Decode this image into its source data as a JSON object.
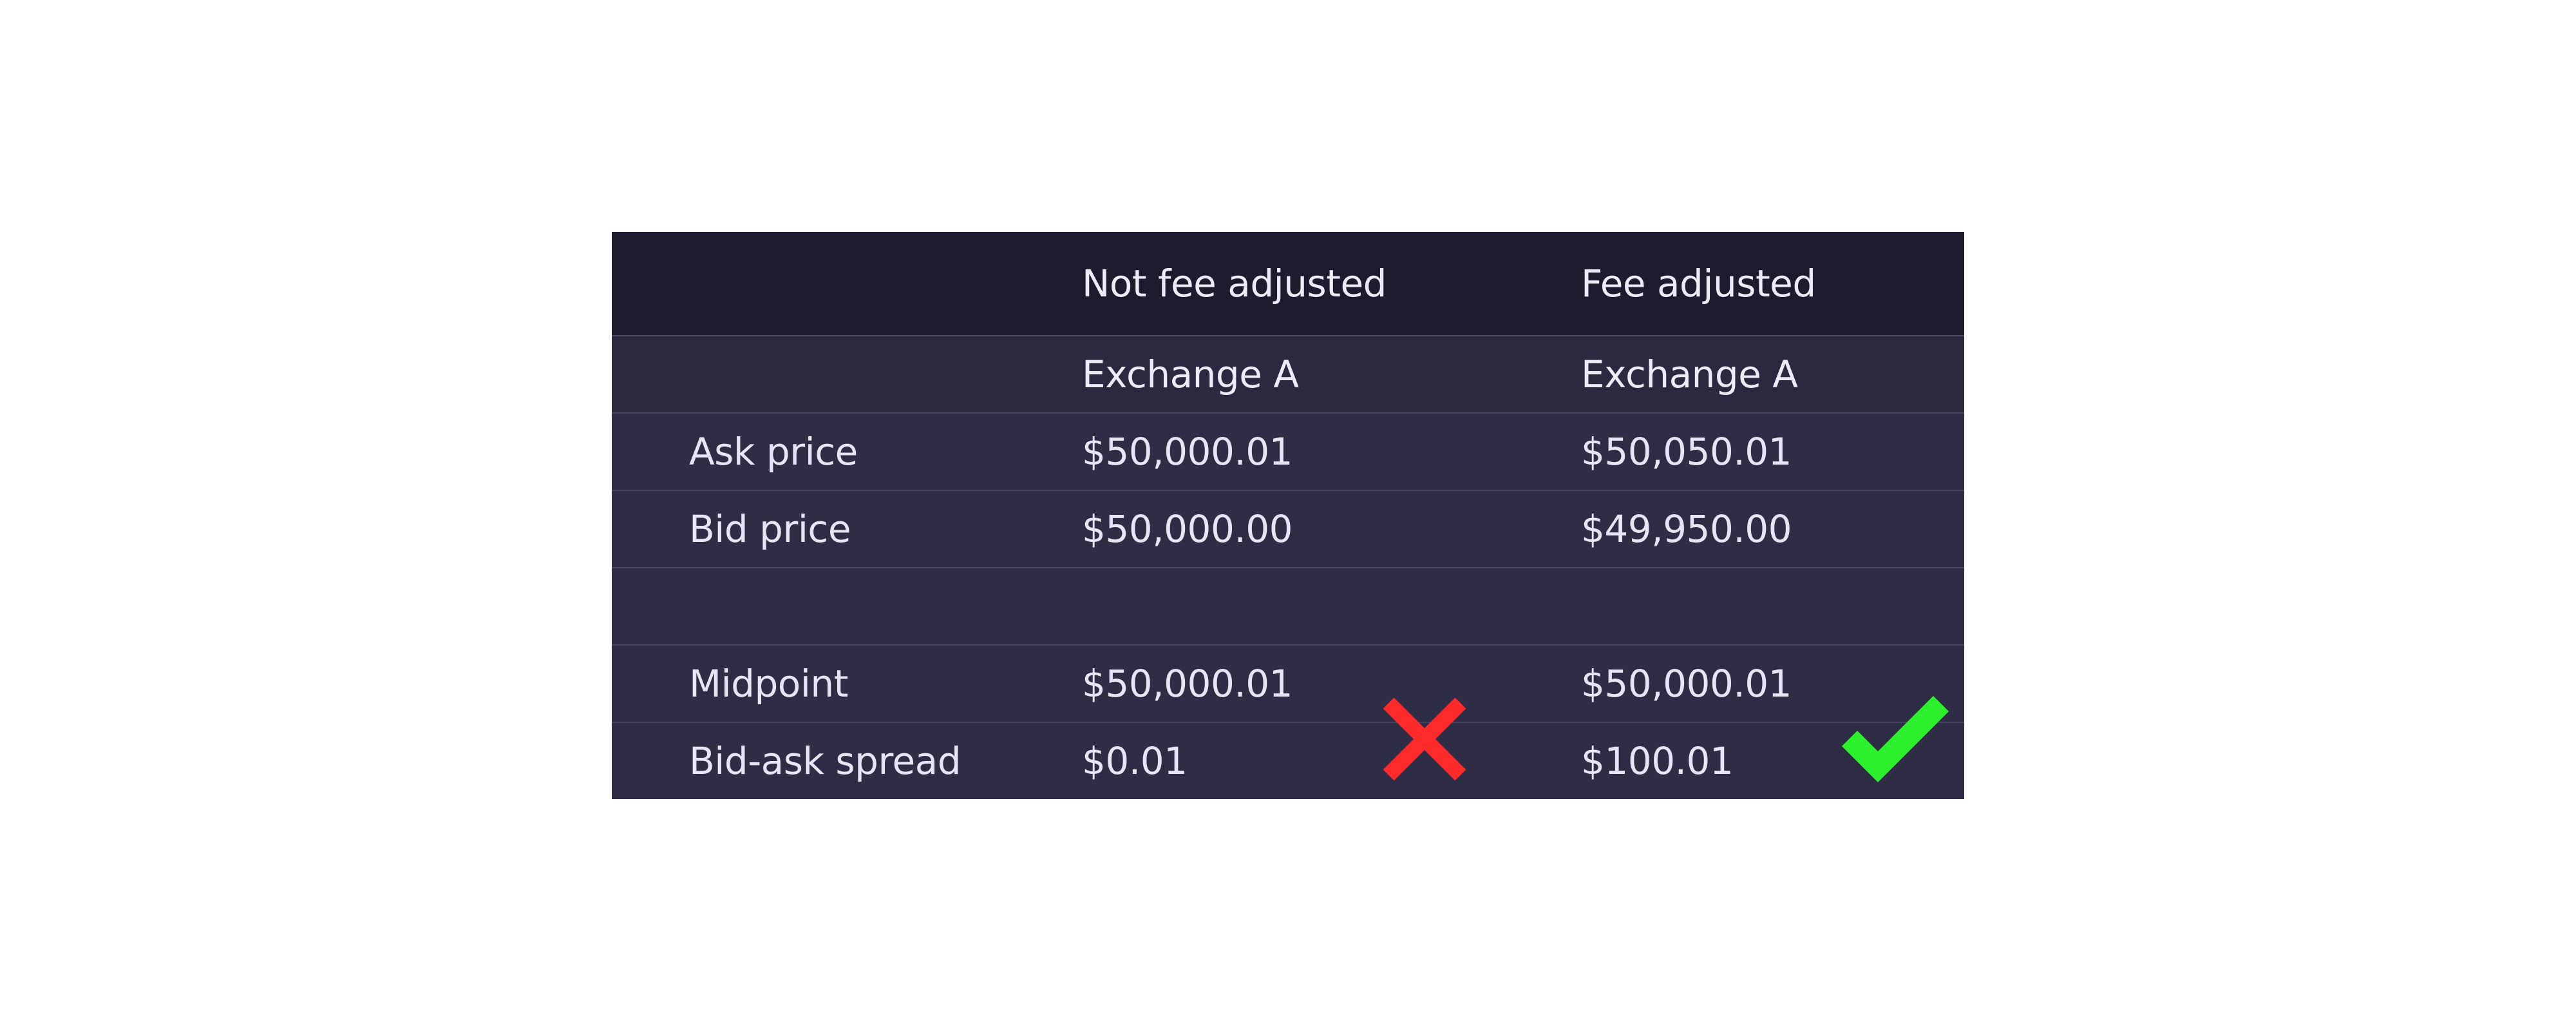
{
  "table": {
    "header": {
      "col_a": "Not fee adjusted",
      "col_b": "Fee adjusted"
    },
    "subheader": {
      "col_a": "Exchange A",
      "col_b": "Exchange A"
    },
    "rows": [
      {
        "label": "Ask price",
        "col_a": "$50,000.01",
        "col_b": "$50,050.01"
      },
      {
        "label": "Bid price",
        "col_a": "$50,000.00",
        "col_b": "$49,950.00"
      },
      {
        "label": "",
        "col_a": "",
        "col_b": ""
      },
      {
        "label": "Midpoint",
        "col_a": "$50,000.01",
        "col_b": "$50,000.01"
      },
      {
        "label": "Bid-ask spread",
        "col_a": "$0.01",
        "col_b": "$100.01"
      }
    ]
  },
  "icons": {
    "not_fee_adjusted_result": "x-mark-icon",
    "fee_adjusted_result": "checkmark-icon"
  },
  "colors": {
    "x_mark": "#ff2a2a",
    "checkmark": "#2df02d",
    "header_bg": "#1d1c2e",
    "table_bg": "#2f2d45"
  }
}
